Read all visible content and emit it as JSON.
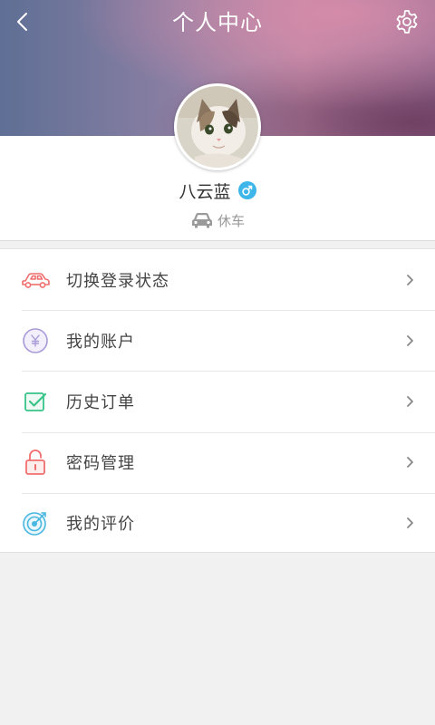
{
  "header": {
    "title": "个人中心",
    "back_icon": "chevron-left-icon",
    "settings_icon": "gear-icon"
  },
  "profile": {
    "avatar": "cat-photo",
    "username": "八云蓝",
    "gender_icon": "male-icon",
    "status_icon": "car-icon",
    "status_text": "休车"
  },
  "menu": {
    "items": [
      {
        "label": "切换登录状态",
        "icon": "car-outline-icon"
      },
      {
        "label": "我的账户",
        "icon": "yen-coin-icon"
      },
      {
        "label": "历史订单",
        "icon": "checkbox-icon"
      },
      {
        "label": "密码管理",
        "icon": "lock-icon"
      },
      {
        "label": "我的评价",
        "icon": "target-icon"
      }
    ]
  },
  "colors": {
    "gender": "#3eb6ea",
    "car_icon": "#f06e6e",
    "yen_icon": "#a99ad8",
    "check_icon": "#39c48a",
    "lock_icon": "#f06e6e",
    "target_icon": "#4ab7e0",
    "status_gray": "#9a9a9a"
  }
}
